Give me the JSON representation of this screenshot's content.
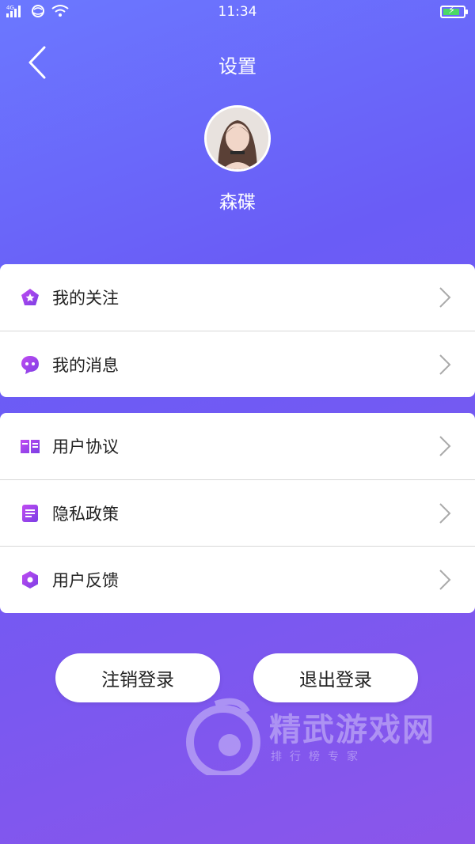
{
  "status_bar": {
    "time": "11:34",
    "signal_label": "4G",
    "icons": [
      "signal-icon",
      "network-icon",
      "wifi-icon",
      "battery-icon"
    ]
  },
  "header": {
    "title": "设置",
    "back_icon": "chevron-left-icon"
  },
  "profile": {
    "username": "森碟",
    "avatar": "avatar-photo"
  },
  "menu_groups": [
    {
      "items": [
        {
          "label": "我的关注",
          "icon": "star-icon"
        },
        {
          "label": "我的消息",
          "icon": "chat-bubble-icon"
        }
      ]
    },
    {
      "items": [
        {
          "label": "用户协议",
          "icon": "book-icon"
        },
        {
          "label": "隐私政策",
          "icon": "document-icon"
        },
        {
          "label": "用户反馈",
          "icon": "hexagon-icon"
        }
      ]
    }
  ],
  "actions": {
    "cancel_account": "注销登录",
    "logout": "退出登录"
  },
  "watermark": {
    "title": "精武游戏网",
    "subtitle": "排行榜专家"
  },
  "colors": {
    "gradient_start": "#6b78ff",
    "gradient_end": "#8b55ea",
    "icon_accent": "#a33ee0"
  }
}
